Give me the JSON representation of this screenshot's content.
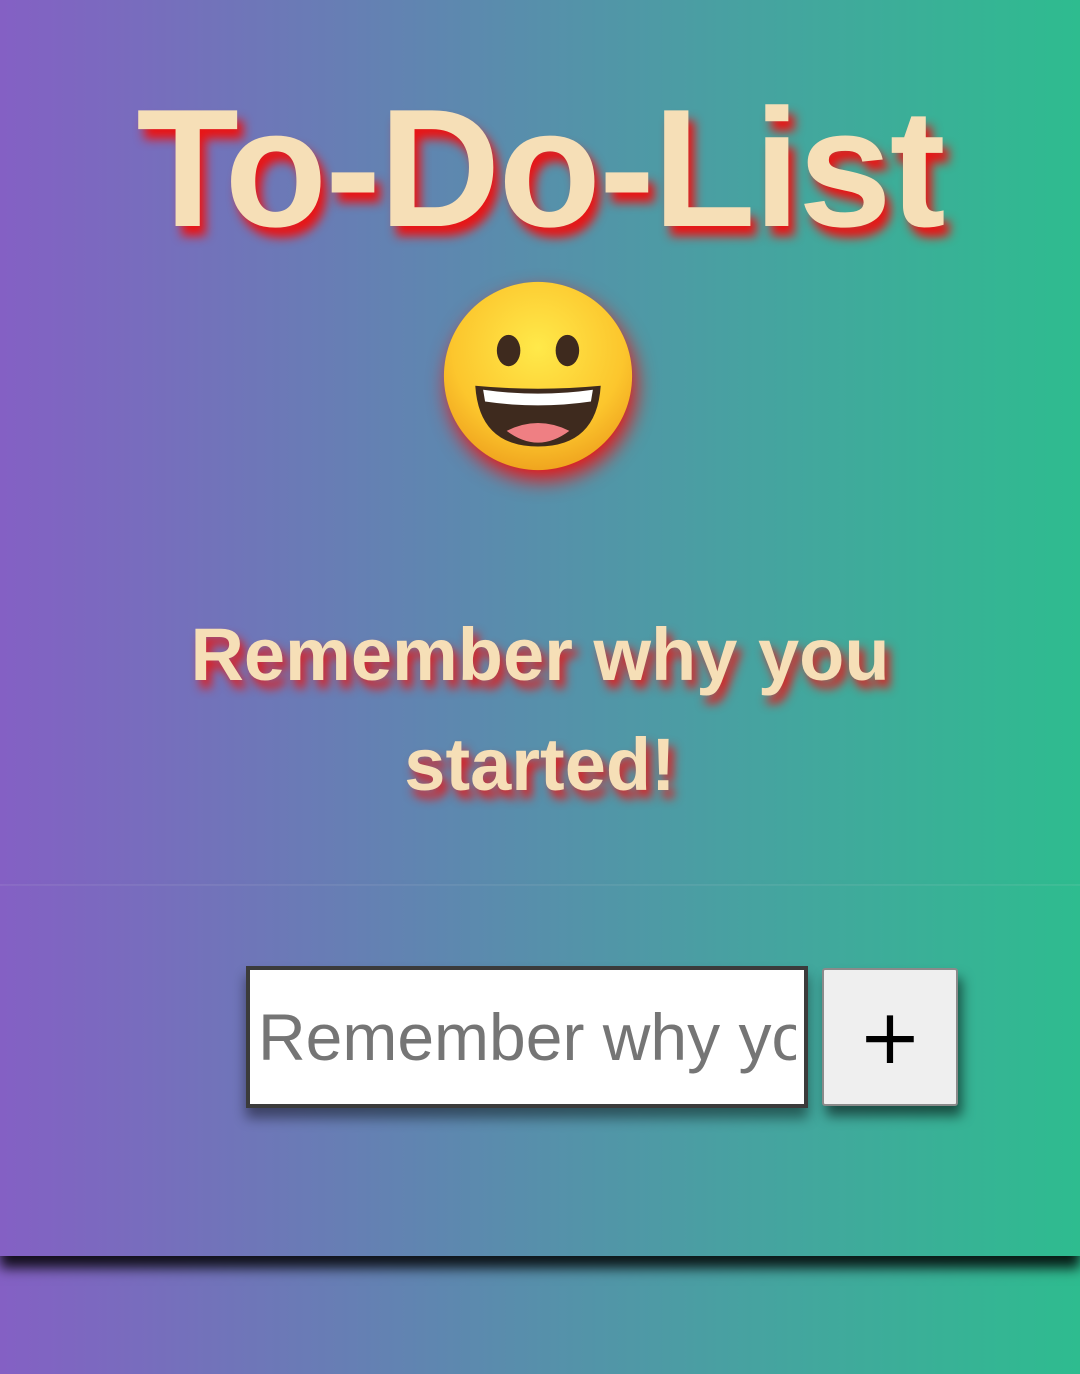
{
  "header": {
    "title": "To-Do-List",
    "emoji_icon": "grinning-face-icon",
    "tagline": "Remember why you started!"
  },
  "form": {
    "input_placeholder": "Remember why you started!",
    "input_value": "",
    "add_button_label": "+"
  },
  "colors": {
    "title_text": "#f6dfb7",
    "title_shadow": "#ea1414",
    "background_start": "#8460c4",
    "background_end": "#2ebc8f"
  }
}
